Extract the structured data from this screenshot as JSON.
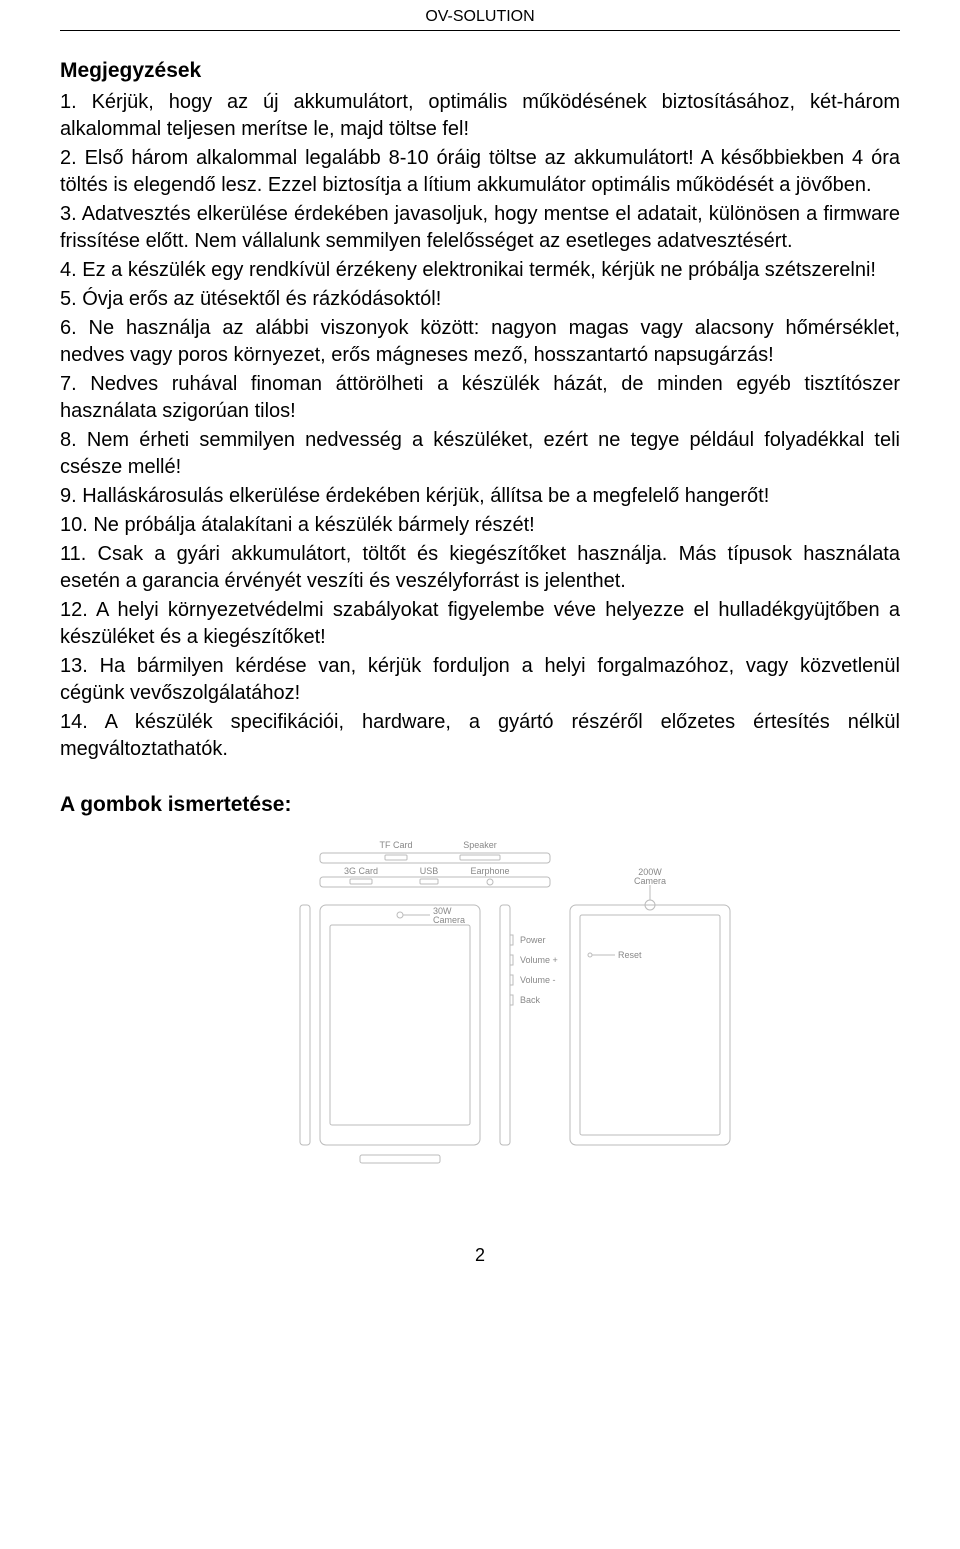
{
  "header": "OV-SOLUTION",
  "title": "Megjegyzések",
  "items": [
    "1. Kérjük, hogy az új akkumulátort, optimális működésének biztosításához, két-három alkalommal teljesen merítse le, majd töltse fel!",
    "2. Első három alkalommal legalább 8-10 óráig töltse az akkumulátort! A későbbiekben 4 óra töltés is elegendő lesz. Ezzel biztosítja a lítium akkumulátor optimális működését a jövőben.",
    "3. Adatvesztés elkerülése érdekében javasoljuk, hogy mentse el adatait, különösen a firmware frissítése előtt. Nem vállalunk semmilyen felelősséget az esetleges adatvesztésért.",
    "4. Ez a készülék egy rendkívül érzékeny elektronikai termék, kérjük ne próbálja szétszerelni!",
    "5. Óvja erős az ütésektől és rázkódásoktól!",
    "6. Ne használja az alábbi viszonyok között: nagyon magas vagy alacsony hőmérséklet, nedves vagy poros környezet, erős mágneses mező, hosszantartó napsugárzás!",
    "7. Nedves ruhával finoman áttörölheti a készülék házát, de minden egyéb tisztítószer használata szigorúan tilos!",
    "8. Nem érheti semmilyen nedvesség a készüléket, ezért ne tegye például folyadékkal teli csésze mellé!",
    "9.  Halláskárosulás elkerülése érdekében kérjük, állítsa be a megfelelő hangerőt!",
    "10. Ne próbálja átalakítani a készülék bármely részét!",
    "11. Csak a gyári akkumulátort, töltőt és kiegészítőket használja. Más típusok használata esetén a garancia érvényét veszíti és veszélyforrást is jelenthet.",
    "12. A helyi környezetvédelmi szabályokat figyelembe véve helyezze el hulladékgyüjtőben a készüléket    és a kiegészítőket!",
    "13. Ha bármilyen kérdése van, kérjük forduljon a helyi forgalmazóhoz, vagy közvetlenül cégünk vevőszolgálatához!",
    "14. A készülék specifikációi, hardware, a gyártó részéről előzetes értesítés nélkül megváltoztathatók."
  ],
  "section2": "A gombok ismertetése:",
  "diagram_labels": {
    "tf_card": "TF Card",
    "speaker": "Speaker",
    "sg_card": "3G Card",
    "usb": "USB",
    "earphone": "Earphone",
    "camera_30w": "30W Camera",
    "camera_200w": "200W Camera",
    "power": "Power",
    "volume_plus": "Volume +",
    "volume_minus": "Volume -",
    "back": "Back",
    "reset": "Reset"
  },
  "page_number": "2"
}
